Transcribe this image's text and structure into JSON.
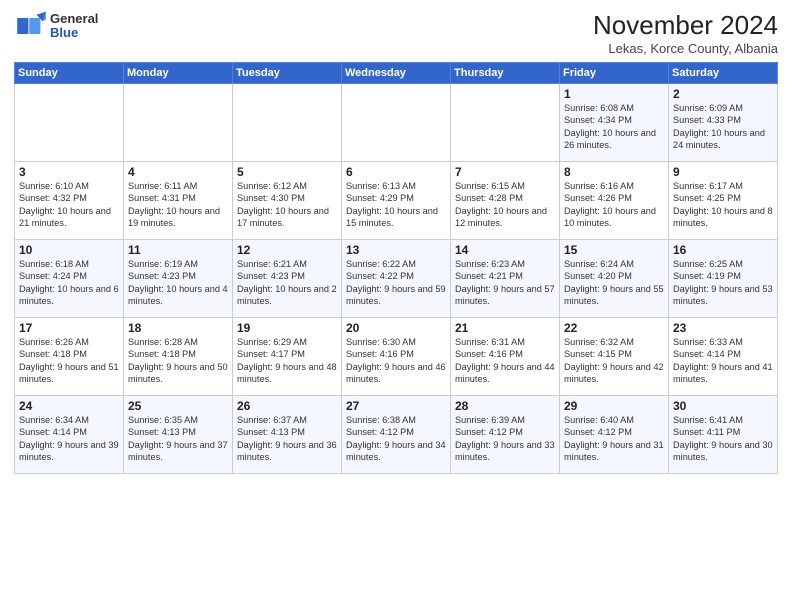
{
  "logo": {
    "line1": "General",
    "line2": "Blue"
  },
  "title": "November 2024",
  "location": "Lekas, Korce County, Albania",
  "days_of_week": [
    "Sunday",
    "Monday",
    "Tuesday",
    "Wednesday",
    "Thursday",
    "Friday",
    "Saturday"
  ],
  "weeks": [
    [
      {
        "day": "",
        "info": ""
      },
      {
        "day": "",
        "info": ""
      },
      {
        "day": "",
        "info": ""
      },
      {
        "day": "",
        "info": ""
      },
      {
        "day": "",
        "info": ""
      },
      {
        "day": "1",
        "info": "Sunrise: 6:08 AM\nSunset: 4:34 PM\nDaylight: 10 hours and 26 minutes."
      },
      {
        "day": "2",
        "info": "Sunrise: 6:09 AM\nSunset: 4:33 PM\nDaylight: 10 hours and 24 minutes."
      }
    ],
    [
      {
        "day": "3",
        "info": "Sunrise: 6:10 AM\nSunset: 4:32 PM\nDaylight: 10 hours and 21 minutes."
      },
      {
        "day": "4",
        "info": "Sunrise: 6:11 AM\nSunset: 4:31 PM\nDaylight: 10 hours and 19 minutes."
      },
      {
        "day": "5",
        "info": "Sunrise: 6:12 AM\nSunset: 4:30 PM\nDaylight: 10 hours and 17 minutes."
      },
      {
        "day": "6",
        "info": "Sunrise: 6:13 AM\nSunset: 4:29 PM\nDaylight: 10 hours and 15 minutes."
      },
      {
        "day": "7",
        "info": "Sunrise: 6:15 AM\nSunset: 4:28 PM\nDaylight: 10 hours and 12 minutes."
      },
      {
        "day": "8",
        "info": "Sunrise: 6:16 AM\nSunset: 4:26 PM\nDaylight: 10 hours and 10 minutes."
      },
      {
        "day": "9",
        "info": "Sunrise: 6:17 AM\nSunset: 4:25 PM\nDaylight: 10 hours and 8 minutes."
      }
    ],
    [
      {
        "day": "10",
        "info": "Sunrise: 6:18 AM\nSunset: 4:24 PM\nDaylight: 10 hours and 6 minutes."
      },
      {
        "day": "11",
        "info": "Sunrise: 6:19 AM\nSunset: 4:23 PM\nDaylight: 10 hours and 4 minutes."
      },
      {
        "day": "12",
        "info": "Sunrise: 6:21 AM\nSunset: 4:23 PM\nDaylight: 10 hours and 2 minutes."
      },
      {
        "day": "13",
        "info": "Sunrise: 6:22 AM\nSunset: 4:22 PM\nDaylight: 9 hours and 59 minutes."
      },
      {
        "day": "14",
        "info": "Sunrise: 6:23 AM\nSunset: 4:21 PM\nDaylight: 9 hours and 57 minutes."
      },
      {
        "day": "15",
        "info": "Sunrise: 6:24 AM\nSunset: 4:20 PM\nDaylight: 9 hours and 55 minutes."
      },
      {
        "day": "16",
        "info": "Sunrise: 6:25 AM\nSunset: 4:19 PM\nDaylight: 9 hours and 53 minutes."
      }
    ],
    [
      {
        "day": "17",
        "info": "Sunrise: 6:26 AM\nSunset: 4:18 PM\nDaylight: 9 hours and 51 minutes."
      },
      {
        "day": "18",
        "info": "Sunrise: 6:28 AM\nSunset: 4:18 PM\nDaylight: 9 hours and 50 minutes."
      },
      {
        "day": "19",
        "info": "Sunrise: 6:29 AM\nSunset: 4:17 PM\nDaylight: 9 hours and 48 minutes."
      },
      {
        "day": "20",
        "info": "Sunrise: 6:30 AM\nSunset: 4:16 PM\nDaylight: 9 hours and 46 minutes."
      },
      {
        "day": "21",
        "info": "Sunrise: 6:31 AM\nSunset: 4:16 PM\nDaylight: 9 hours and 44 minutes."
      },
      {
        "day": "22",
        "info": "Sunrise: 6:32 AM\nSunset: 4:15 PM\nDaylight: 9 hours and 42 minutes."
      },
      {
        "day": "23",
        "info": "Sunrise: 6:33 AM\nSunset: 4:14 PM\nDaylight: 9 hours and 41 minutes."
      }
    ],
    [
      {
        "day": "24",
        "info": "Sunrise: 6:34 AM\nSunset: 4:14 PM\nDaylight: 9 hours and 39 minutes."
      },
      {
        "day": "25",
        "info": "Sunrise: 6:35 AM\nSunset: 4:13 PM\nDaylight: 9 hours and 37 minutes."
      },
      {
        "day": "26",
        "info": "Sunrise: 6:37 AM\nSunset: 4:13 PM\nDaylight: 9 hours and 36 minutes."
      },
      {
        "day": "27",
        "info": "Sunrise: 6:38 AM\nSunset: 4:12 PM\nDaylight: 9 hours and 34 minutes."
      },
      {
        "day": "28",
        "info": "Sunrise: 6:39 AM\nSunset: 4:12 PM\nDaylight: 9 hours and 33 minutes."
      },
      {
        "day": "29",
        "info": "Sunrise: 6:40 AM\nSunset: 4:12 PM\nDaylight: 9 hours and 31 minutes."
      },
      {
        "day": "30",
        "info": "Sunrise: 6:41 AM\nSunset: 4:11 PM\nDaylight: 9 hours and 30 minutes."
      }
    ]
  ]
}
